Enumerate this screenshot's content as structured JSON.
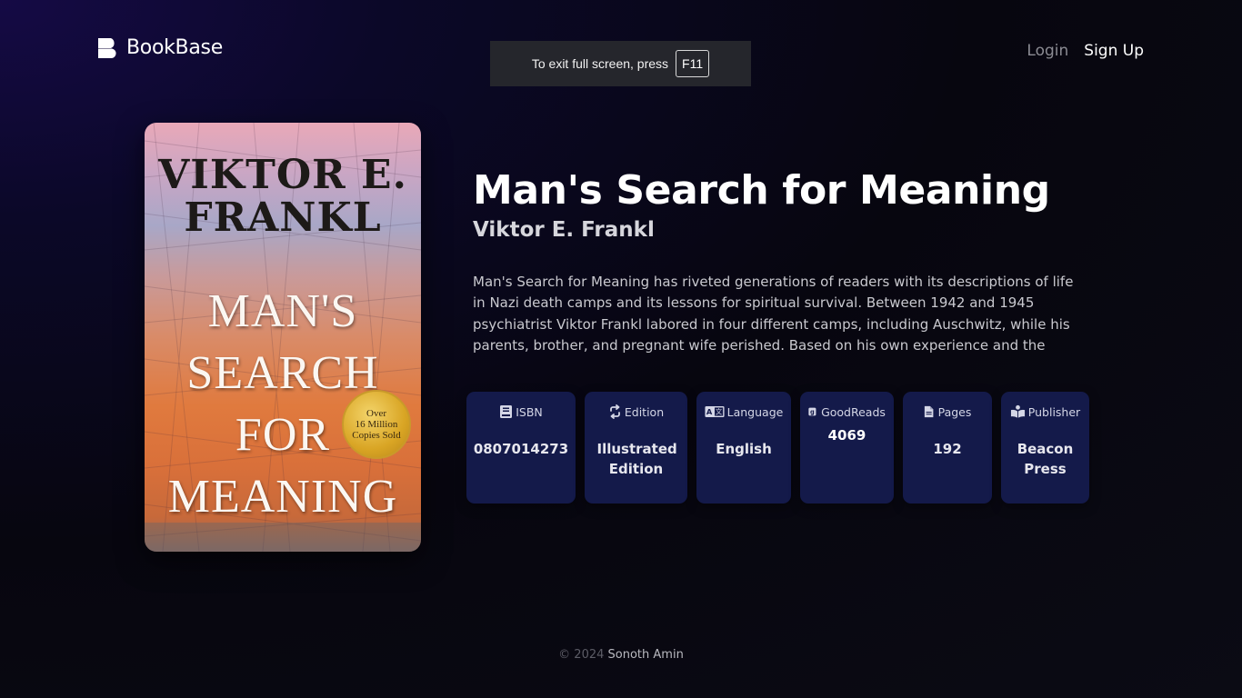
{
  "brand": {
    "name": "BookBase",
    "icon": "bookbase-logo-icon"
  },
  "fullscreen_toast": {
    "text": "To exit full screen, press",
    "key": "F11"
  },
  "nav": {
    "login": "Login",
    "signup": "Sign Up"
  },
  "cover": {
    "author": [
      "VIKTOR E.",
      "FRANKL"
    ],
    "title": [
      "MAN'S",
      "SEARCH",
      "FOR",
      "MEANING"
    ],
    "seal": [
      "Over",
      "16 Million",
      "Copies Sold"
    ]
  },
  "book": {
    "title": "Man's Search for Meaning",
    "author": "Viktor E. Frankl",
    "description": "Man's Search for Meaning has riveted generations of readers with its descriptions of life in Nazi death camps and its lessons for spiritual survival. Between 1942 and 1945 psychiatrist Viktor Frankl labored in four different camps, including Auschwitz, while his parents, brother, and pregnant wife perished. Based on his own experience and the stories of his many patients, Frankl argues that we cannot avoid suffering but we can"
  },
  "stats": [
    {
      "label": "ISBN",
      "value": "0807014273",
      "icon": "book-icon"
    },
    {
      "label": "Edition",
      "value": "Illustrated Edition",
      "icon": "repeat-icon"
    },
    {
      "label": "Language",
      "value": "English",
      "icon": "language-icon"
    },
    {
      "label": "GoodReads",
      "value": "4069",
      "icon": "goodreads-icon"
    },
    {
      "label": "Pages",
      "value": "192",
      "icon": "file-icon"
    },
    {
      "label": "Publisher",
      "value": "Beacon Press",
      "icon": "reader-icon"
    }
  ],
  "footer": {
    "copyright": "© 2024",
    "owner": "Sonoth Amin"
  },
  "colors": {
    "card_bg": "#141a4a",
    "page_bg": "#07060f",
    "accent_top_left": "#150a45"
  }
}
